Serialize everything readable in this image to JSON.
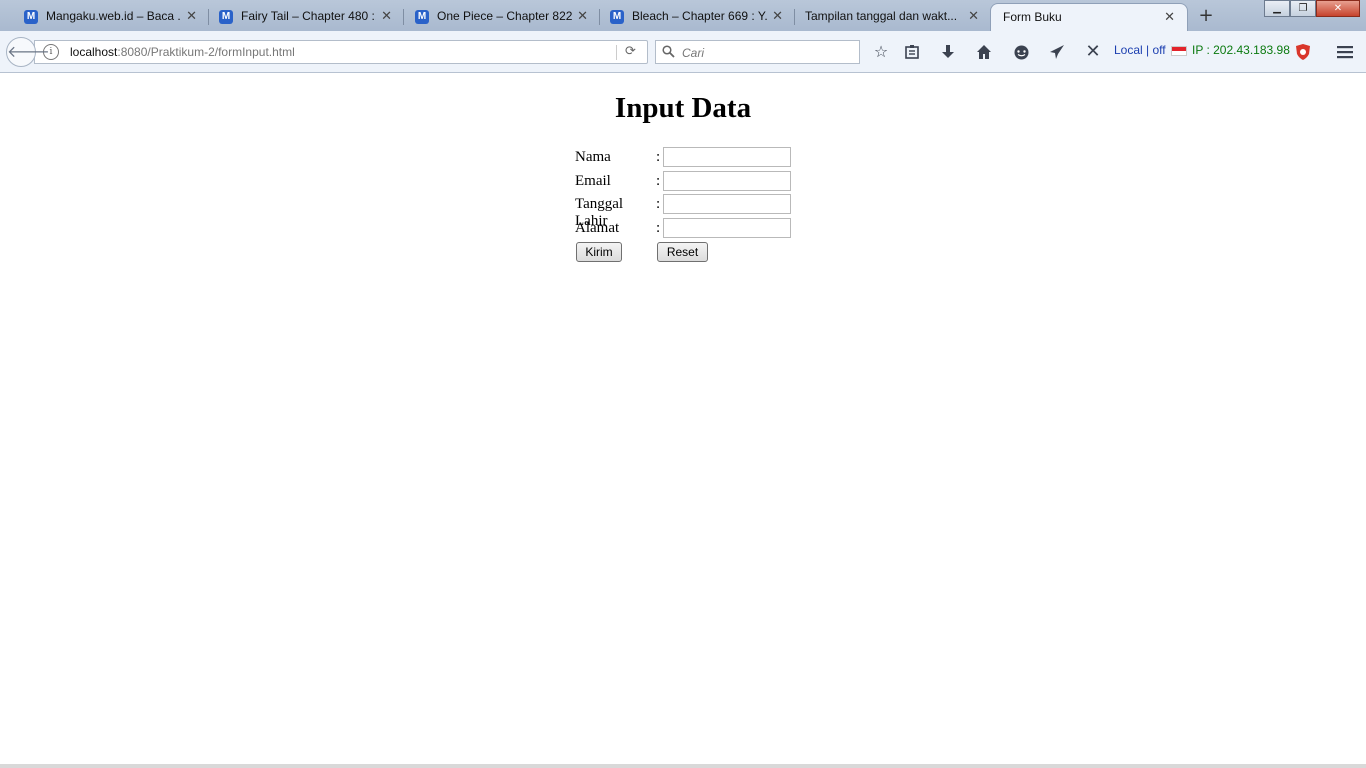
{
  "browser": {
    "tabs": [
      {
        "title": "Mangaku.web.id – Baca ...",
        "favicon": "M"
      },
      {
        "title": "Fairy Tail – Chapter 480 :...",
        "favicon": "M"
      },
      {
        "title": "One Piece – Chapter 822...",
        "favicon": "M"
      },
      {
        "title": "Bleach – Chapter 669 : Y...",
        "favicon": "M"
      },
      {
        "title": "Tampilan tanggal dan wakt...",
        "favicon": ""
      },
      {
        "title": "Form Buku",
        "favicon": "",
        "active": true
      }
    ],
    "new_tab": "+",
    "window_controls": {
      "minimize": "▁",
      "maximize": "❐",
      "close": "✕"
    },
    "url": {
      "host": "localhost",
      "rest": ":8080/Praktikum-2/formInput.html"
    },
    "search": {
      "placeholder": "Cari"
    },
    "extension": {
      "status": "Local | off",
      "ip_label": "IP : 202.43.183.98"
    },
    "icons": [
      "back-arrow-icon",
      "info-icon",
      "reload-icon",
      "search-icon",
      "bookmark-star-icon",
      "reading-list-icon",
      "download-icon",
      "home-icon",
      "chat-icon",
      "send-icon",
      "x-icon",
      "flag-icon",
      "shield-icon",
      "menu-icon"
    ]
  },
  "page": {
    "title": "Input Data",
    "fields": [
      {
        "label": "Nama",
        "value": ""
      },
      {
        "label": "Email",
        "value": ""
      },
      {
        "label": "Tanggal Lahir",
        "value": ""
      },
      {
        "label": "Alamat",
        "value": ""
      }
    ],
    "separator": ":",
    "buttons": {
      "submit": "Kirim",
      "reset": "Reset"
    }
  }
}
